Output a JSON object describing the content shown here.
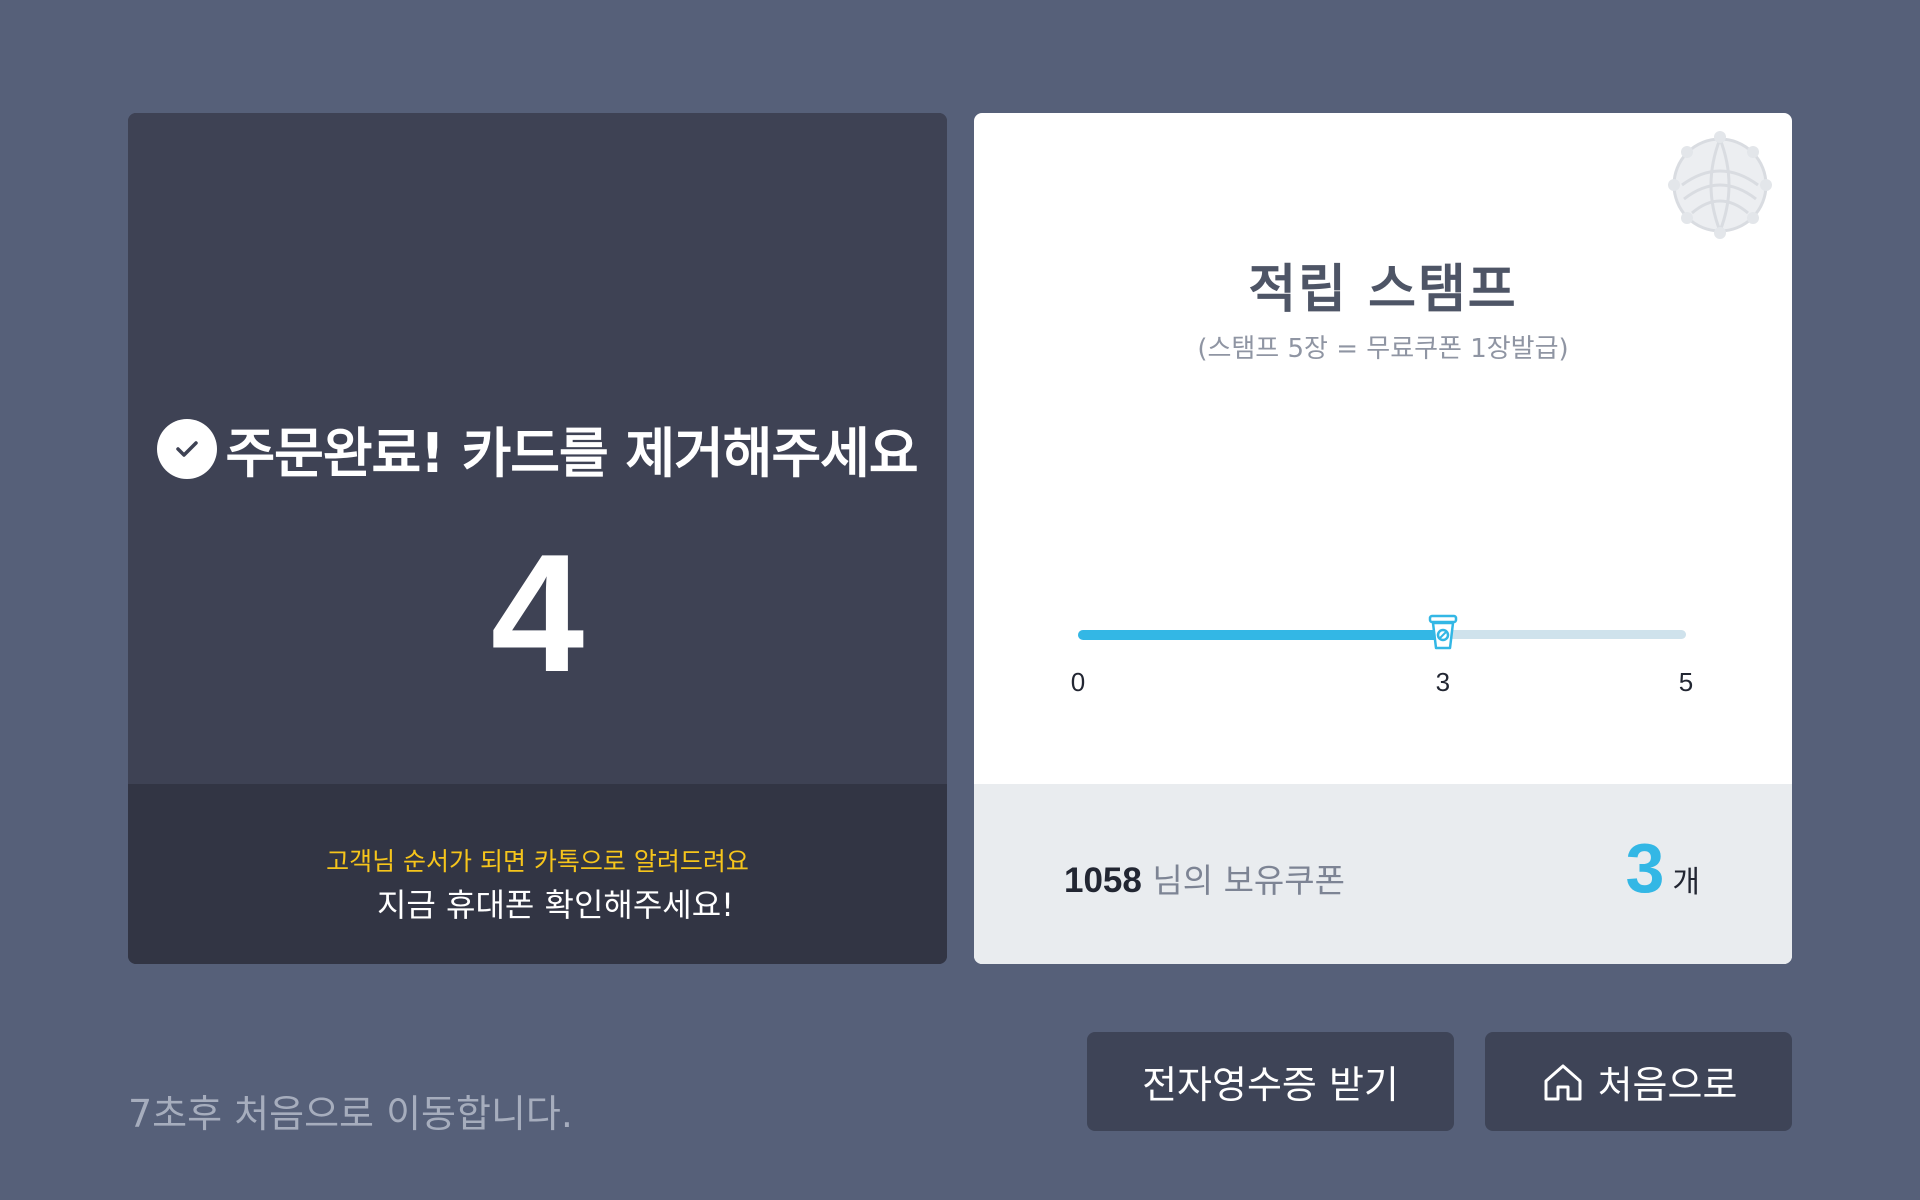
{
  "order": {
    "title": "주문완료! 카드를 제거해주세요",
    "number": "4",
    "notice_kakao": "고객님 순서가 되면 카톡으로 알려드려요",
    "notice_phone": "지금 휴대폰 확인해주세요!"
  },
  "stamp": {
    "title": "적립 스탬프",
    "subtitle": "(스탬프 5장 = 무료쿠폰 1장발급)",
    "progress": {
      "min": 0,
      "max": 5,
      "current": 3,
      "ticks": [
        "0",
        "3",
        "5"
      ],
      "fill_color": "#33b7e5",
      "track_color": "#cfe2ec"
    },
    "seal_icon": "stamp-seal-icon",
    "marker_icon": "coffee-cup-icon"
  },
  "coupon": {
    "user": "1058",
    "label": " 님의 보유쿠폰",
    "count": "3",
    "unit": "개"
  },
  "bottom": {
    "countdown": "7초후 처음으로 이동합니다.",
    "receipt_button": "전자영수증 받기",
    "home_button": "처음으로",
    "home_icon": "home-icon"
  },
  "colors": {
    "background": "#566079",
    "card_dark": "#3e4254",
    "card_footer_dark": "#323544",
    "accent_blue": "#33b7e5",
    "notice_yellow": "#f6c51b"
  }
}
